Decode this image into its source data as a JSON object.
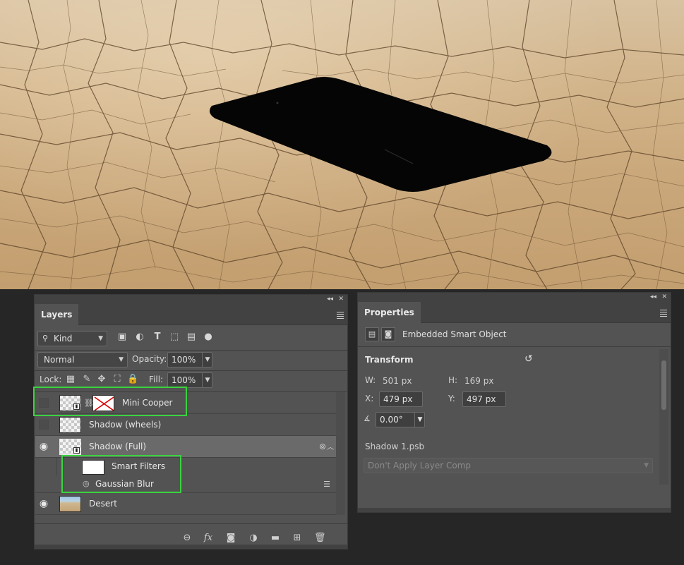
{
  "layers_panel": {
    "tab_label": "Layers",
    "filter": {
      "kind_label": "Kind"
    },
    "blend_mode": "Normal",
    "opacity_label": "Opacity:",
    "opacity_value": "100%",
    "lock_label": "Lock:",
    "fill_label": "Fill:",
    "fill_value": "100%",
    "layers": [
      {
        "name": "Mini Cooper",
        "visible": false
      },
      {
        "name": "Shadow (wheels)",
        "visible": false
      },
      {
        "name": "Shadow (Full)",
        "visible": true
      },
      {
        "name": "Smart Filters"
      },
      {
        "name": "Gaussian Blur"
      },
      {
        "name": "Desert",
        "visible": true
      }
    ]
  },
  "properties_panel": {
    "tab_label": "Properties",
    "object_type": "Embedded Smart Object",
    "transform_label": "Transform",
    "w_label": "W:",
    "w_value": "501 px",
    "h_label": "H:",
    "h_value": "169 px",
    "x_label": "X:",
    "x_value": "479 px",
    "y_label": "Y:",
    "y_value": "497 px",
    "angle_value": "0.00°",
    "file_name": "Shadow 1.psb",
    "layer_comp_placeholder": "Don't Apply Layer Comp"
  },
  "colors": {
    "highlight": "#3ad33f",
    "panel_bg": "#535353",
    "app_bg": "#262626"
  }
}
